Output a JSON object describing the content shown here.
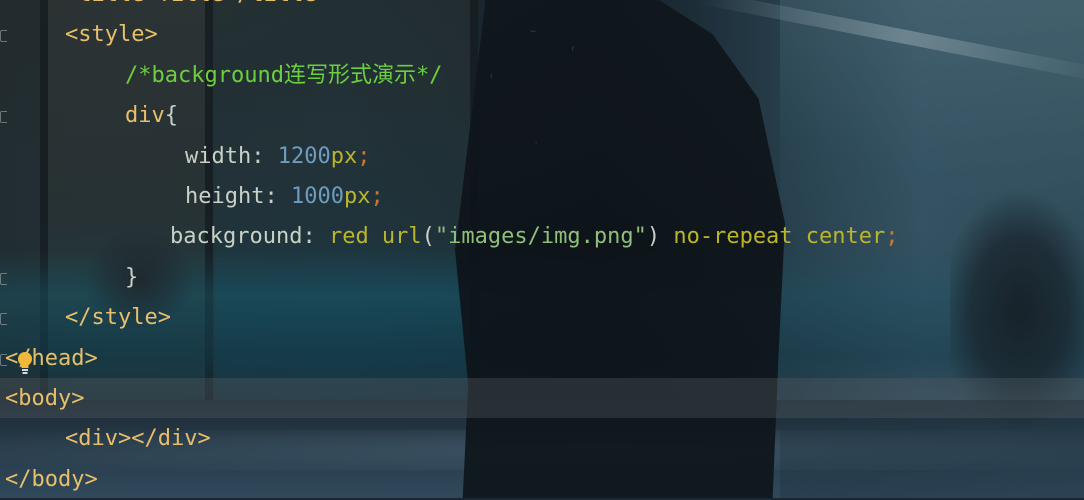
{
  "editor": {
    "lines": [
      {
        "indent": 2,
        "segments": [
          {
            "cls": "tag",
            "text": "<title>Title</title>"
          }
        ]
      },
      {
        "indent": 2,
        "segments": [
          {
            "cls": "tag",
            "text": "<style>"
          }
        ]
      },
      {
        "indent": 4,
        "segments": [
          {
            "cls": "comment",
            "text": "/*background连写形式演示*/"
          }
        ]
      },
      {
        "indent": 4,
        "segments": [
          {
            "cls": "tag",
            "text": "div"
          },
          {
            "cls": "plain",
            "text": "{"
          }
        ]
      },
      {
        "indent": 6,
        "segments": [
          {
            "cls": "plain",
            "text": "width: "
          },
          {
            "cls": "number",
            "text": "1200"
          },
          {
            "cls": "value",
            "text": "px"
          },
          {
            "cls": "punct",
            "text": ";"
          }
        ]
      },
      {
        "indent": 6,
        "segments": [
          {
            "cls": "plain",
            "text": "height: "
          },
          {
            "cls": "number",
            "text": "1000"
          },
          {
            "cls": "value",
            "text": "px"
          },
          {
            "cls": "punct",
            "text": ";"
          }
        ]
      },
      {
        "indent": 5.5,
        "segments": [
          {
            "cls": "plain",
            "text": "background: "
          },
          {
            "cls": "value",
            "text": "red url"
          },
          {
            "cls": "paren",
            "text": "("
          },
          {
            "cls": "string",
            "text": "\"images/img.png\""
          },
          {
            "cls": "paren",
            "text": ")"
          },
          {
            "cls": "plain",
            "text": " "
          },
          {
            "cls": "value",
            "text": "no-repeat center"
          },
          {
            "cls": "punct",
            "text": ";"
          }
        ]
      },
      {
        "indent": 4,
        "segments": [
          {
            "cls": "plain",
            "text": "}"
          }
        ]
      },
      {
        "indent": 2,
        "segments": [
          {
            "cls": "tag",
            "text": "</style>"
          }
        ]
      },
      {
        "indent": 0,
        "segments": [
          {
            "cls": "tag",
            "text": "</head>"
          }
        ]
      },
      {
        "indent": 0,
        "segments": [
          {
            "cls": "tag",
            "text": "<body>"
          }
        ]
      },
      {
        "indent": 2,
        "segments": [
          {
            "cls": "tag",
            "text": "<div></div>"
          }
        ]
      },
      {
        "indent": 0,
        "segments": [
          {
            "cls": "tag",
            "text": "</body>"
          }
        ]
      }
    ],
    "current_line": 10,
    "gutter_markers": [
      1,
      3,
      7,
      8,
      9
    ],
    "intention_bulb_icon": "lightbulb-icon"
  },
  "colors": {
    "tag": "#e8bf6a",
    "comment": "#6ccf3e",
    "number": "#6d9cbe",
    "punctuation": "#cc7832",
    "keyword_value": "#bbb529",
    "string": "#8fbf7a",
    "text": "#c9d1c6"
  }
}
